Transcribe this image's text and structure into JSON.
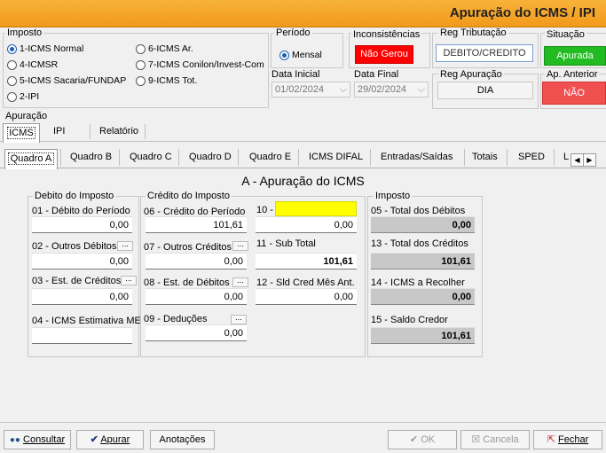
{
  "window": {
    "title": "Apuração do ICMS / IPI"
  },
  "imposto": {
    "label": "Imposto",
    "options": [
      {
        "label": "1-ICMS Normal",
        "selected": true
      },
      {
        "label": "4-ICMSR",
        "selected": false
      },
      {
        "label": "5-ICMS Sacaria/FUNDAP",
        "selected": false
      },
      {
        "label": "2-IPI",
        "selected": false
      },
      {
        "label": "6-ICMS Ar.",
        "selected": false
      },
      {
        "label": "7-ICMS Conilon/Invest-Com",
        "selected": false
      },
      {
        "label": "9-ICMS Tot.",
        "selected": false
      }
    ]
  },
  "periodo": {
    "label": "Período",
    "option": "Mensal",
    "data_inicial_label": "Data Inicial",
    "data_inicial": "01/02/2024",
    "data_final_label": "Data Final",
    "data_final": "29/02/2024"
  },
  "inconsistencias": {
    "label": "Inconsistências",
    "value": "Não Gerou",
    "color": "#ff0000"
  },
  "reg_tributacao": {
    "label": "Reg Tributação",
    "value": "DEBITO/CREDITO"
  },
  "situacao": {
    "label": "Situação",
    "value": "Apurada",
    "color": "#22bb22"
  },
  "reg_apuracao": {
    "label": "Reg Apuração",
    "value": "DIA"
  },
  "ap_anterior": {
    "label": "Ap. Anterior",
    "value": "NÃO",
    "color": "#f05050"
  },
  "apuracao": {
    "label": "Apuração",
    "tabs": [
      "ICMS",
      "IPI",
      "Relatório"
    ]
  },
  "subtabs": [
    "Quadro A",
    "Quadro B",
    "Quadro C",
    "Quadro D",
    "Quadro E",
    "ICMS DIFAL",
    "Entradas/Saídas",
    "Totais",
    "SPED",
    "L"
  ],
  "panel": {
    "title": "A - Apuração do ICMS",
    "debito": {
      "label": "Debito do Imposto",
      "f01": {
        "label": "01 - Débito do Período",
        "value": "0,00"
      },
      "f02": {
        "label": "02 - Outros Débitos",
        "value": "0,00"
      },
      "f03": {
        "label": "03 - Est. de Créditos",
        "value": "0,00"
      },
      "f04": {
        "label": "04 - ICMS Estimativa ME",
        "value": ""
      }
    },
    "credito": {
      "label": "Crédito do Imposto",
      "f06": {
        "label": "06 - Crédito do Período",
        "value": "101,61"
      },
      "f07": {
        "label": "07 - Outros Créditos",
        "value": "0,00"
      },
      "f08": {
        "label": "08 - Est. de Débitos",
        "value": "0,00"
      },
      "f09": {
        "label": "09 - Deduções",
        "value": "0,00"
      },
      "f10": {
        "label": "10 -",
        "value": "0,00"
      },
      "f11": {
        "label": "11 - Sub Total",
        "value": "101,61"
      },
      "f12": {
        "label": "12 - Sld Cred Mês Ant.",
        "value": "0,00"
      }
    },
    "imposto": {
      "label": "Imposto",
      "f05": {
        "label": "05 - Total dos Débitos",
        "value": "0,00"
      },
      "f13": {
        "label": "13 - Total dos Créditos",
        "value": "101,61"
      },
      "f14": {
        "label": "14 - ICMS a Recolher",
        "value": "0,00"
      },
      "f15": {
        "label": "15 - Saldo Credor",
        "value": "101,61"
      }
    }
  },
  "buttons": {
    "consultar": "Consultar",
    "apurar": "Apurar",
    "anotacoes": "Anotações",
    "ok": "OK",
    "cancela": "Cancela",
    "fechar": "Fechar"
  }
}
